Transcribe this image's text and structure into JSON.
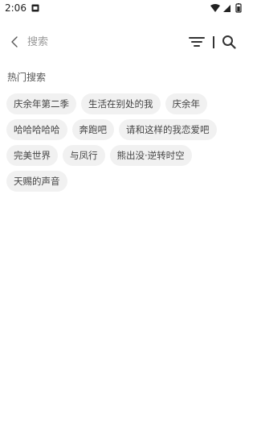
{
  "status_bar": {
    "time": "2:06"
  },
  "search": {
    "placeholder": "搜索",
    "value": ""
  },
  "hot_search": {
    "title": "热门搜索",
    "tags": [
      "庆余年第二季",
      "生活在别处的我",
      "庆余年",
      "哈哈哈哈哈",
      "奔跑吧",
      "请和这样的我恋爱吧",
      "完美世界",
      "与凤行",
      "熊出没·逆转时空",
      "天赐的声音"
    ]
  },
  "colors": {
    "tag_background": "#f1f1f1",
    "icon": "#333333",
    "placeholder": "#9a9a9a"
  }
}
